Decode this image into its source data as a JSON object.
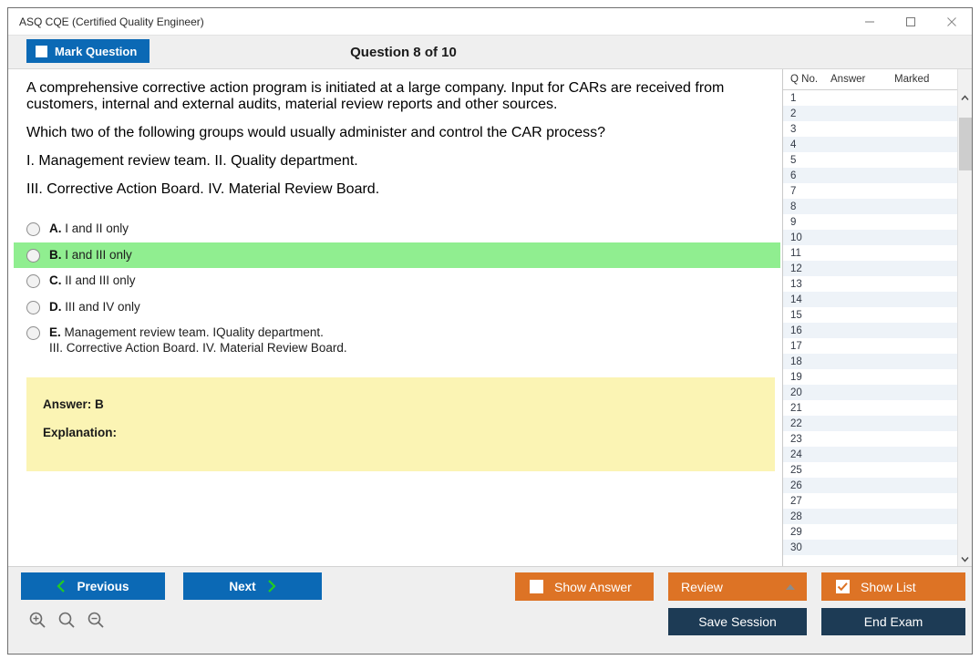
{
  "window": {
    "title": "ASQ CQE (Certified Quality Engineer)",
    "controls": {
      "minimize": "minimize-icon",
      "maximize": "maximize-icon",
      "close": "close-icon"
    }
  },
  "header": {
    "mark_question_label": "Mark Question",
    "mark_question_checked": false,
    "question_title": "Question 8 of 10"
  },
  "question": {
    "paragraph1": "A comprehensive corrective action program is initiated at a large company. Input for CARs are received from customers, internal and external audits, material review reports and other sources.",
    "paragraph2": "Which two of the following groups would usually administer and control the CAR process?",
    "paragraph3": "I. Management review team. II. Quality department.",
    "paragraph4": "III. Corrective Action Board. IV. Material Review Board.",
    "options": [
      {
        "letter": "A.",
        "text": "I and II only",
        "text2": "",
        "selected": false
      },
      {
        "letter": "B.",
        "text": "I and III only",
        "text2": "",
        "selected": true
      },
      {
        "letter": "C.",
        "text": "II and III only",
        "text2": "",
        "selected": false
      },
      {
        "letter": "D.",
        "text": "III and IV only",
        "text2": "",
        "selected": false
      },
      {
        "letter": "E.",
        "text": "Management review team. IQuality department.",
        "text2": "III. Corrective Action Board. IV. Material Review Board.",
        "selected": false
      }
    ]
  },
  "answer_panel": {
    "answer_label": "Answer: B",
    "explanation_label": "Explanation:"
  },
  "list_panel": {
    "columns": [
      "Q No.",
      "Answer",
      "Marked"
    ],
    "rows": [
      {
        "qno": "1",
        "answer": "",
        "marked": ""
      },
      {
        "qno": "2",
        "answer": "",
        "marked": ""
      },
      {
        "qno": "3",
        "answer": "",
        "marked": ""
      },
      {
        "qno": "4",
        "answer": "",
        "marked": ""
      },
      {
        "qno": "5",
        "answer": "",
        "marked": ""
      },
      {
        "qno": "6",
        "answer": "",
        "marked": ""
      },
      {
        "qno": "7",
        "answer": "",
        "marked": ""
      },
      {
        "qno": "8",
        "answer": "",
        "marked": ""
      },
      {
        "qno": "9",
        "answer": "",
        "marked": ""
      },
      {
        "qno": "10",
        "answer": "",
        "marked": ""
      },
      {
        "qno": "11",
        "answer": "",
        "marked": ""
      },
      {
        "qno": "12",
        "answer": "",
        "marked": ""
      },
      {
        "qno": "13",
        "answer": "",
        "marked": ""
      },
      {
        "qno": "14",
        "answer": "",
        "marked": ""
      },
      {
        "qno": "15",
        "answer": "",
        "marked": ""
      },
      {
        "qno": "16",
        "answer": "",
        "marked": ""
      },
      {
        "qno": "17",
        "answer": "",
        "marked": ""
      },
      {
        "qno": "18",
        "answer": "",
        "marked": ""
      },
      {
        "qno": "19",
        "answer": "",
        "marked": ""
      },
      {
        "qno": "20",
        "answer": "",
        "marked": ""
      },
      {
        "qno": "21",
        "answer": "",
        "marked": ""
      },
      {
        "qno": "22",
        "answer": "",
        "marked": ""
      },
      {
        "qno": "23",
        "answer": "",
        "marked": ""
      },
      {
        "qno": "24",
        "answer": "",
        "marked": ""
      },
      {
        "qno": "25",
        "answer": "",
        "marked": ""
      },
      {
        "qno": "26",
        "answer": "",
        "marked": ""
      },
      {
        "qno": "27",
        "answer": "",
        "marked": ""
      },
      {
        "qno": "28",
        "answer": "",
        "marked": ""
      },
      {
        "qno": "29",
        "answer": "",
        "marked": ""
      },
      {
        "qno": "30",
        "answer": "",
        "marked": ""
      }
    ]
  },
  "footer": {
    "previous_label": "Previous",
    "next_label": "Next",
    "show_answer_label": "Show Answer",
    "show_answer_checked": false,
    "review_label": "Review",
    "show_list_label": "Show List",
    "show_list_checked": true,
    "save_session_label": "Save Session",
    "end_exam_label": "End Exam",
    "zoom_in_icon": "zoom-in-icon",
    "zoom_reset_icon": "zoom-reset-icon",
    "zoom_out_icon": "zoom-out-icon"
  },
  "colors": {
    "primary_blue": "#0b69b5",
    "accent_orange": "#dd7325",
    "navy": "#1d3b55",
    "selected_green": "#90ee90",
    "answer_yellow": "#fbf4b4",
    "chevron_green": "#22cc22"
  }
}
